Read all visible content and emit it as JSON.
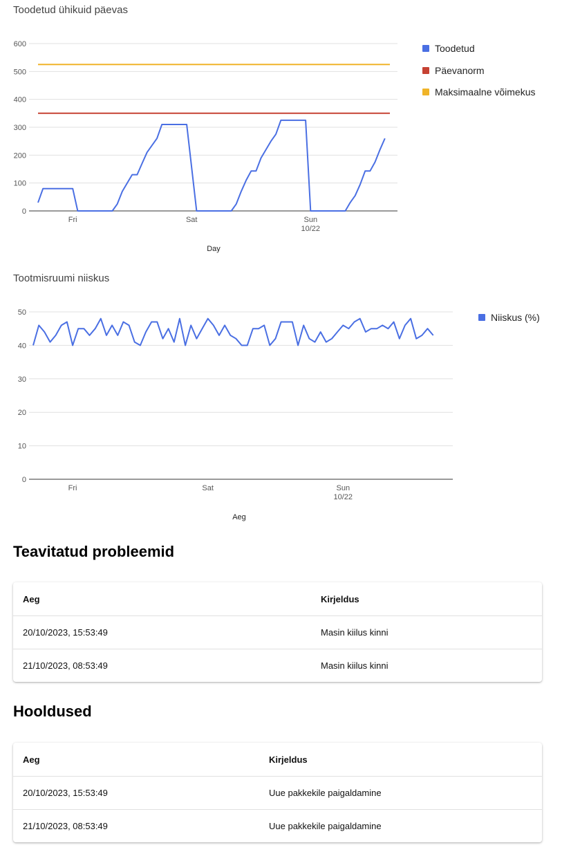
{
  "chart_data": [
    {
      "type": "line",
      "title": "Toodetud ühikuid päevas",
      "xlabel": "Day",
      "ylabel": "",
      "ylim": [
        0,
        600
      ],
      "yticks": [
        0,
        100,
        200,
        300,
        400,
        500,
        600
      ],
      "x_range": [
        "2023-10-19T17:00",
        "2023-10-22T16:00"
      ],
      "xticks": [
        {
          "x": "2023-10-20T00:00",
          "label": "Fri",
          "sublabel": ""
        },
        {
          "x": "2023-10-21T00:00",
          "label": "Sat",
          "sublabel": ""
        },
        {
          "x": "2023-10-22T00:00",
          "label": "Sun",
          "sublabel": "10/22"
        }
      ],
      "grid": true,
      "legend": "right",
      "series": [
        {
          "name": "Toodetud",
          "color": "#4a6fe3",
          "points": [
            [
              "2023-10-19T17:00",
              30
            ],
            [
              "2023-10-19T18:00",
              80
            ],
            [
              "2023-10-19T19:00",
              80
            ],
            [
              "2023-10-19T20:00",
              80
            ],
            [
              "2023-10-19T21:00",
              80
            ],
            [
              "2023-10-19T22:00",
              80
            ],
            [
              "2023-10-19T23:00",
              80
            ],
            [
              "2023-10-20T00:00",
              80
            ],
            [
              "2023-10-20T01:00",
              0
            ],
            [
              "2023-10-20T02:00",
              0
            ],
            [
              "2023-10-20T03:00",
              0
            ],
            [
              "2023-10-20T04:00",
              0
            ],
            [
              "2023-10-20T05:00",
              0
            ],
            [
              "2023-10-20T06:00",
              0
            ],
            [
              "2023-10-20T07:00",
              0
            ],
            [
              "2023-10-20T08:00",
              0
            ],
            [
              "2023-10-20T09:00",
              25
            ],
            [
              "2023-10-20T10:00",
              70
            ],
            [
              "2023-10-20T11:00",
              100
            ],
            [
              "2023-10-20T12:00",
              130
            ],
            [
              "2023-10-20T13:00",
              130
            ],
            [
              "2023-10-20T14:00",
              170
            ],
            [
              "2023-10-20T15:00",
              210
            ],
            [
              "2023-10-20T16:00",
              235
            ],
            [
              "2023-10-20T17:00",
              260
            ],
            [
              "2023-10-20T18:00",
              310
            ],
            [
              "2023-10-20T19:00",
              310
            ],
            [
              "2023-10-20T20:00",
              310
            ],
            [
              "2023-10-20T21:00",
              310
            ],
            [
              "2023-10-20T22:00",
              310
            ],
            [
              "2023-10-20T23:00",
              310
            ],
            [
              "2023-10-21T01:00",
              0
            ],
            [
              "2023-10-21T02:00",
              0
            ],
            [
              "2023-10-21T03:00",
              0
            ],
            [
              "2023-10-21T04:00",
              0
            ],
            [
              "2023-10-21T05:00",
              0
            ],
            [
              "2023-10-21T06:00",
              0
            ],
            [
              "2023-10-21T07:00",
              0
            ],
            [
              "2023-10-21T08:00",
              0
            ],
            [
              "2023-10-21T09:00",
              25
            ],
            [
              "2023-10-21T10:00",
              70
            ],
            [
              "2023-10-21T11:00",
              110
            ],
            [
              "2023-10-21T12:00",
              143
            ],
            [
              "2023-10-21T13:00",
              143
            ],
            [
              "2023-10-21T14:00",
              190
            ],
            [
              "2023-10-21T15:00",
              220
            ],
            [
              "2023-10-21T16:00",
              250
            ],
            [
              "2023-10-21T17:00",
              275
            ],
            [
              "2023-10-21T18:00",
              325
            ],
            [
              "2023-10-21T19:00",
              325
            ],
            [
              "2023-10-21T20:00",
              325
            ],
            [
              "2023-10-21T21:00",
              325
            ],
            [
              "2023-10-21T22:00",
              325
            ],
            [
              "2023-10-21T23:00",
              325
            ],
            [
              "2023-10-22T00:00",
              0
            ],
            [
              "2023-10-22T01:00",
              0
            ],
            [
              "2023-10-22T02:00",
              0
            ],
            [
              "2023-10-22T03:00",
              0
            ],
            [
              "2023-10-22T04:00",
              0
            ],
            [
              "2023-10-22T05:00",
              0
            ],
            [
              "2023-10-22T06:00",
              0
            ],
            [
              "2023-10-22T07:00",
              0
            ],
            [
              "2023-10-22T08:00",
              30
            ],
            [
              "2023-10-22T09:00",
              55
            ],
            [
              "2023-10-22T10:00",
              95
            ],
            [
              "2023-10-22T11:00",
              143
            ],
            [
              "2023-10-22T12:00",
              143
            ],
            [
              "2023-10-22T13:00",
              175
            ],
            [
              "2023-10-22T14:00",
              220
            ],
            [
              "2023-10-22T15:00",
              260
            ]
          ]
        },
        {
          "name": "Päevanorm",
          "color": "#c64233",
          "points": [
            [
              "2023-10-19T17:00",
              350
            ],
            [
              "2023-10-22T16:00",
              350
            ]
          ]
        },
        {
          "name": "Maksimaalne võimekus",
          "color": "#f0b429",
          "points": [
            [
              "2023-10-19T17:00",
              525
            ],
            [
              "2023-10-22T16:00",
              525
            ]
          ]
        }
      ]
    },
    {
      "type": "line",
      "title": "Tootmisruumi niiskus",
      "xlabel": "Aeg",
      "ylabel": "",
      "ylim": [
        0,
        50
      ],
      "yticks": [
        0,
        10,
        20,
        30,
        40,
        50
      ],
      "x_range": [
        "2023-10-19T17:00",
        "2023-10-22T18:00"
      ],
      "xticks": [
        {
          "x": "2023-10-20T00:00",
          "label": "Fri",
          "sublabel": ""
        },
        {
          "x": "2023-10-21T00:00",
          "label": "Sat",
          "sublabel": ""
        },
        {
          "x": "2023-10-22T00:00",
          "label": "Sun",
          "sublabel": "10/22"
        }
      ],
      "grid": true,
      "legend": "right",
      "series": [
        {
          "name": "Niiskus (%)",
          "color": "#4a6fe3",
          "values_start": "2023-10-19T17:00",
          "values_step_hours": 1,
          "values": [
            40,
            46,
            44,
            41,
            43,
            46,
            47,
            40,
            45,
            45,
            43,
            45,
            48,
            43,
            46,
            43,
            47,
            46,
            41,
            40,
            44,
            47,
            47,
            42,
            45,
            41,
            48,
            40,
            46,
            42,
            45,
            48,
            46,
            43,
            46,
            43,
            42,
            40,
            40,
            45,
            45,
            46,
            40,
            42,
            47,
            47,
            47,
            40,
            46,
            42,
            41,
            44,
            41,
            42,
            44,
            46,
            45,
            47,
            48,
            44,
            45,
            45,
            46,
            45,
            47,
            42,
            46,
            48,
            42,
            43,
            45,
            43
          ]
        }
      ]
    }
  ],
  "problems": {
    "title": "Teavitatud probleemid",
    "columns": [
      "Aeg",
      "Kirjeldus"
    ],
    "rows": [
      [
        "20/10/2023, 15:53:49",
        "Masin kiilus kinni"
      ],
      [
        "21/10/2023, 08:53:49",
        "Masin kiilus kinni"
      ]
    ]
  },
  "maintenance": {
    "title": "Hooldused",
    "columns": [
      "Aeg",
      "Kirjeldus"
    ],
    "rows": [
      [
        "20/10/2023, 15:53:49",
        "Uue pakkekile paigaldamine"
      ],
      [
        "21/10/2023, 08:53:49",
        "Uue pakkekile paigaldamine"
      ]
    ]
  }
}
